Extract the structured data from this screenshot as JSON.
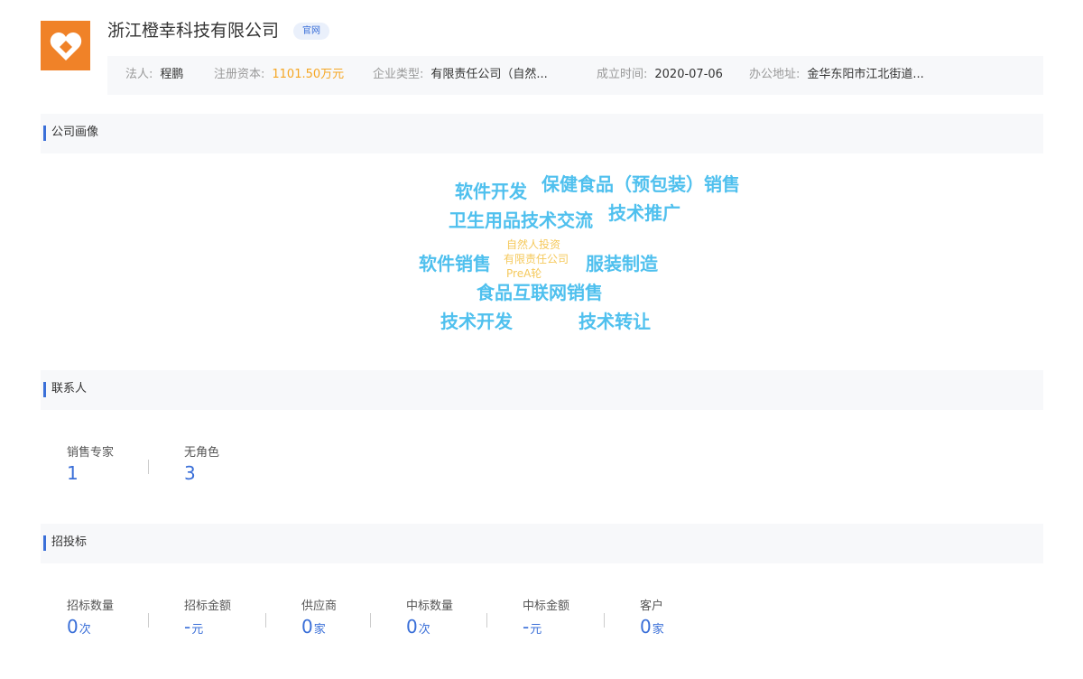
{
  "company": {
    "name": "浙江橙幸科技有限公司",
    "official_tag": "官网",
    "logo_icon": "heart-icon",
    "brand_color": "#f08228"
  },
  "info": [
    {
      "label": "法人:",
      "value": "程鹏"
    },
    {
      "label": "注册资本:",
      "value": "1101.50万元"
    },
    {
      "label": "企业类型:",
      "value": "有限责任公司（自然..."
    },
    {
      "label": "成立时间:",
      "value": "2020-07-06"
    },
    {
      "label": "办公地址:",
      "value": "金华东阳市江北街道..."
    }
  ],
  "sections": {
    "portrait": {
      "title": "公司画像"
    },
    "contacts": {
      "title": "联系人"
    },
    "bidding": {
      "title": "招投标"
    }
  },
  "word_cloud": [
    {
      "text": "软件开发"
    },
    {
      "text": "保健食品（预包装）销售"
    },
    {
      "text": "卫生用品技术交流"
    },
    {
      "text": "技术推广"
    },
    {
      "text": "自然人投资"
    },
    {
      "text": "有限责任公司"
    },
    {
      "text": "PreA轮"
    },
    {
      "text": "软件销售"
    },
    {
      "text": "服装制造"
    },
    {
      "text": "食品互联网销售"
    },
    {
      "text": "技术开发"
    },
    {
      "text": "技术转让"
    }
  ],
  "contacts": [
    {
      "label": "销售专家",
      "value": "1"
    },
    {
      "label": "无角色",
      "value": "3"
    }
  ],
  "bidding": [
    {
      "label": "招标数量",
      "value": "0",
      "unit": "次"
    },
    {
      "label": "招标金额",
      "value": "-",
      "unit": "元"
    },
    {
      "label": "供应商",
      "value": "0",
      "unit": "家"
    },
    {
      "label": "中标数量",
      "value": "0",
      "unit": "次"
    },
    {
      "label": "中标金额",
      "value": "-",
      "unit": "元"
    },
    {
      "label": "客户",
      "value": "0",
      "unit": "家"
    }
  ],
  "colors": {
    "accent": "#3a6fd8",
    "money": "#f5a623",
    "cloud_primary": "#4fc0ee",
    "cloud_secondary": "#f5c95c"
  }
}
